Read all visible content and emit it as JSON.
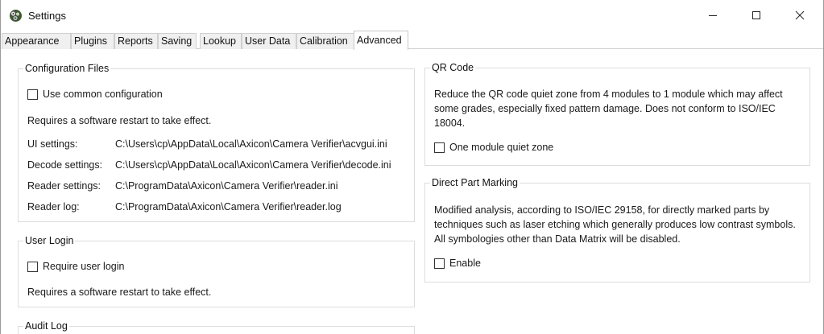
{
  "window": {
    "title": "Settings",
    "app_icon": "gear-cluster-icon",
    "controls": {
      "minimize": "minimize-icon",
      "maximize": "maximize-icon",
      "close": "close-icon"
    }
  },
  "tabs": [
    {
      "label": "Appearance"
    },
    {
      "label": "Plugins"
    },
    {
      "label": "Reports"
    },
    {
      "label": "Saving"
    },
    {
      "label": "Lookup"
    },
    {
      "label": "User Data"
    },
    {
      "label": "Calibration"
    },
    {
      "label": "Advanced",
      "active": true
    }
  ],
  "config_files": {
    "title": "Configuration Files",
    "use_common_label": "Use common configuration",
    "restart_note": "Requires a software restart to take effect.",
    "entries": [
      {
        "label": "UI settings:",
        "path": "C:\\Users\\cp\\AppData\\Local\\Axicon\\Camera Verifier\\acvgui.ini"
      },
      {
        "label": "Decode settings:",
        "path": "C:\\Users\\cp\\AppData\\Local\\Axicon\\Camera Verifier\\decode.ini"
      },
      {
        "label": "Reader settings:",
        "path": "C:\\ProgramData\\Axicon\\Camera Verifier\\reader.ini"
      },
      {
        "label": "Reader log:",
        "path": "C:\\ProgramData\\Axicon\\Camera Verifier\\reader.log"
      }
    ]
  },
  "user_login": {
    "title": "User Login",
    "require_label": "Require user login",
    "restart_note": "Requires a software restart to take effect."
  },
  "audit_log": {
    "title": "Audit Log"
  },
  "qr_code": {
    "title": "QR Code",
    "description": "Reduce the QR code quiet zone from 4 modules to 1 module which may affect some grades, especially fixed pattern damage.  Does not conform to ISO/IEC 18004.",
    "one_module_label": "One module quiet zone"
  },
  "dpm": {
    "title": "Direct Part Marking",
    "description": "Modified analysis, according to ISO/IEC 29158, for directly marked parts by techniques such as laser etching which generally produces low contrast symbols.  All symbologies other than Data Matrix will be disabled.",
    "enable_label": "Enable"
  }
}
